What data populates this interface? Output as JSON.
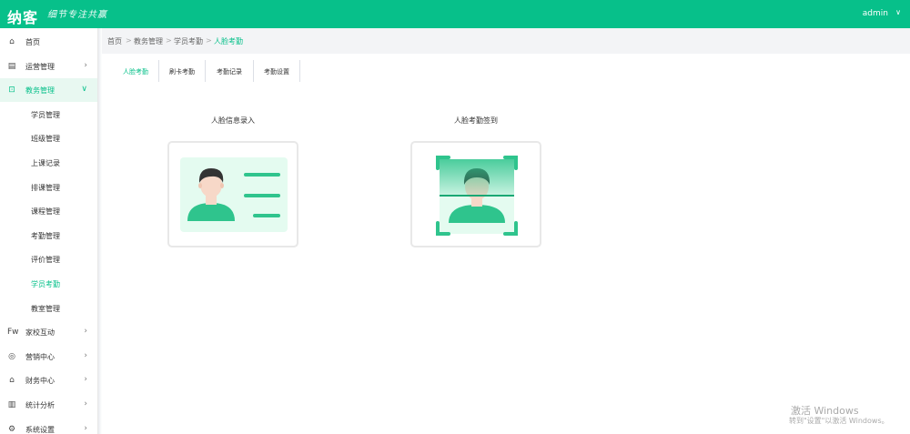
{
  "header": {
    "logo": "纳客",
    "slogan": "细节专注共赢",
    "user": "admin"
  },
  "sidebar": {
    "items": [
      {
        "label": "首页",
        "icon": "home-icon",
        "glyph": "⌂",
        "has_arrow": false
      },
      {
        "label": "运营管理",
        "icon": "document-icon",
        "glyph": "▤",
        "has_arrow": true
      },
      {
        "label": "教务管理",
        "icon": "book-icon",
        "glyph": "⊡",
        "has_arrow": true,
        "active": true,
        "expanded": true
      },
      {
        "label": "家校互动",
        "icon": "chat-icon",
        "glyph": "Fw",
        "has_arrow": true
      },
      {
        "label": "营销中心",
        "icon": "globe-icon",
        "glyph": "◎",
        "has_arrow": true
      },
      {
        "label": "财务中心",
        "icon": "bank-icon",
        "glyph": "⌂",
        "has_arrow": true
      },
      {
        "label": "统计分析",
        "icon": "chart-icon",
        "glyph": "▥",
        "has_arrow": true
      },
      {
        "label": "系统设置",
        "icon": "gear-icon",
        "glyph": "⚙",
        "has_arrow": true
      }
    ],
    "sub_items": [
      {
        "label": "学员管理"
      },
      {
        "label": "班级管理"
      },
      {
        "label": "上课记录"
      },
      {
        "label": "排课管理"
      },
      {
        "label": "课程管理"
      },
      {
        "label": "考勤管理"
      },
      {
        "label": "评价管理"
      },
      {
        "label": "学员考勤",
        "active": true
      },
      {
        "label": "教室管理"
      }
    ]
  },
  "breadcrumb": [
    "首页",
    "教务管理",
    "学员考勤",
    "人脸考勤"
  ],
  "tabs": [
    {
      "label": "人脸考勤",
      "active": true
    },
    {
      "label": "刷卡考勤"
    },
    {
      "label": "考勤记录"
    },
    {
      "label": "考勤设置"
    }
  ],
  "cards": [
    {
      "title": "人脸信息录入"
    },
    {
      "title": "人脸考勤签到"
    }
  ],
  "watermark": {
    "line1": "激活 Windows",
    "line2": "转到\"设置\"以激活 Windows。"
  },
  "colors": {
    "primary": "#07c08a",
    "light_green": "#e4fbf0",
    "skin": "#f7d8c8",
    "hair": "#333333"
  }
}
